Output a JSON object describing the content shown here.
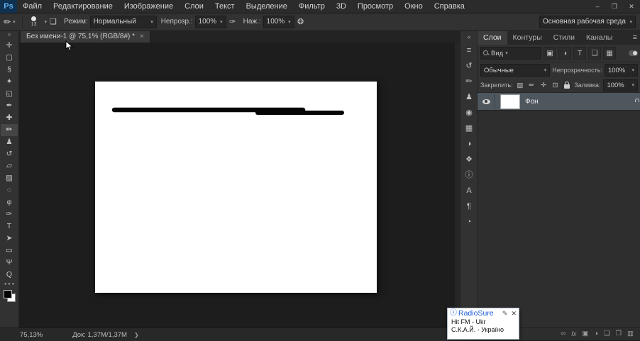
{
  "ui": {
    "caret": "▾"
  },
  "titlebar": {
    "logo": "Ps",
    "menus": [
      "Файл",
      "Редактирование",
      "Изображение",
      "Слои",
      "Текст",
      "Выделение",
      "Фильтр",
      "3D",
      "Просмотр",
      "Окно",
      "Справка"
    ],
    "minimize": "–",
    "restore": "❐",
    "close": "✕"
  },
  "options": {
    "tool_glyph": "✏",
    "brush_size": "13",
    "panel_toggle_glyph": "❏",
    "mode_label": "Режим:",
    "mode_value": "Нормальный",
    "opacity_label": "Непрозр.:",
    "opacity_value": "100%",
    "pressure_glyph": "✑",
    "flow_label": "Наж.:",
    "flow_value": "100%",
    "airbrush_glyph": "❂",
    "workspace_value": "Основная рабочая среда"
  },
  "doc_tab": {
    "title": "Без имени-1 @ 75,1% (RGB/8#) *",
    "close": "×"
  },
  "toolbar": {
    "collapse": "»",
    "more": "● ● ●",
    "tools": [
      {
        "name": "move",
        "glyph": "✛"
      },
      {
        "name": "marquee",
        "glyph": "▢"
      },
      {
        "name": "lasso",
        "glyph": "§"
      },
      {
        "name": "quick-selection",
        "glyph": "✦"
      },
      {
        "name": "crop",
        "glyph": "◱"
      },
      {
        "name": "eyedropper",
        "glyph": "✒"
      },
      {
        "name": "healing-brush",
        "glyph": "✚"
      },
      {
        "name": "brush",
        "glyph": "✏"
      },
      {
        "name": "clone-stamp",
        "glyph": "♟"
      },
      {
        "name": "history-brush",
        "glyph": "↺"
      },
      {
        "name": "eraser",
        "glyph": "▱"
      },
      {
        "name": "gradient",
        "glyph": "▨"
      },
      {
        "name": "blur",
        "glyph": "◌"
      },
      {
        "name": "dodge",
        "glyph": "φ"
      },
      {
        "name": "pen",
        "glyph": "✑"
      },
      {
        "name": "type",
        "glyph": "T"
      },
      {
        "name": "path-selection",
        "glyph": "➤"
      },
      {
        "name": "shape",
        "glyph": "▭"
      },
      {
        "name": "hand",
        "glyph": "Ψ"
      },
      {
        "name": "zoom",
        "glyph": "Q"
      }
    ]
  },
  "strip": {
    "collapse": "«",
    "icons": [
      {
        "name": "properties-panel",
        "glyph": "≡"
      },
      {
        "name": "history-panel",
        "glyph": "↺"
      },
      {
        "name": "brush-settings-panel",
        "glyph": "✏"
      },
      {
        "name": "clone-source-panel",
        "glyph": "♟"
      },
      {
        "name": "color-panel",
        "glyph": "◉"
      },
      {
        "name": "swatches-panel",
        "glyph": "▦"
      },
      {
        "name": "adjustments-panel",
        "glyph": "◑"
      },
      {
        "name": "styles-panel",
        "glyph": "❖"
      },
      {
        "name": "info-panel",
        "glyph": "ⓘ"
      },
      {
        "name": "character-panel",
        "glyph": "А"
      },
      {
        "name": "paragraph-panel",
        "glyph": "¶"
      },
      {
        "name": "timeline-panel",
        "glyph": "◔"
      }
    ]
  },
  "panel": {
    "tabs": [
      "Слои",
      "Контуры",
      "Стили",
      "Каналы"
    ],
    "menu_glyph": "≡",
    "filter": {
      "label": "Вид",
      "buttons": [
        {
          "name": "filter-pixel-layers",
          "glyph": "▣"
        },
        {
          "name": "filter-adjustment-layers",
          "glyph": "◑"
        },
        {
          "name": "filter-type-layers",
          "glyph": "T"
        },
        {
          "name": "filter-shape-layers",
          "glyph": "❏"
        },
        {
          "name": "filter-smart-objects",
          "glyph": "▦"
        }
      ]
    },
    "blend": {
      "value": "Обычные",
      "opacity_label": "Непрозрачность:",
      "opacity_value": "100%"
    },
    "lock": {
      "label": "Закрепить:",
      "icons": [
        {
          "name": "lock-transparency",
          "glyph": "▨"
        },
        {
          "name": "lock-pixels",
          "glyph": "✏"
        },
        {
          "name": "lock-position",
          "glyph": "✛"
        },
        {
          "name": "lock-artboard",
          "glyph": "⊡"
        }
      ],
      "fill_label": "Заливка:",
      "fill_value": "100%"
    },
    "layer": {
      "name": "Фон"
    },
    "footer": [
      {
        "name": "link-layers",
        "glyph": "∞"
      },
      {
        "name": "layer-effects",
        "glyph": "fx"
      },
      {
        "name": "add-layer-mask",
        "glyph": "▣"
      },
      {
        "name": "new-adjustment-layer",
        "glyph": "◑"
      },
      {
        "name": "new-group",
        "glyph": "❏"
      },
      {
        "name": "new-layer",
        "glyph": "❐"
      },
      {
        "name": "delete-layer",
        "glyph": "▥"
      }
    ]
  },
  "status": {
    "zoom": "75,13%",
    "doc": "Док: 1,37M/1,37M",
    "arrow": "❯"
  },
  "radiosure": {
    "info_glyph": "ⓘ",
    "title": "RadioSure",
    "wrench_glyph": "✎",
    "close": "✕",
    "line1": "Hit FM - Ukr",
    "line2": "С.К.А.Й. - Україно"
  }
}
